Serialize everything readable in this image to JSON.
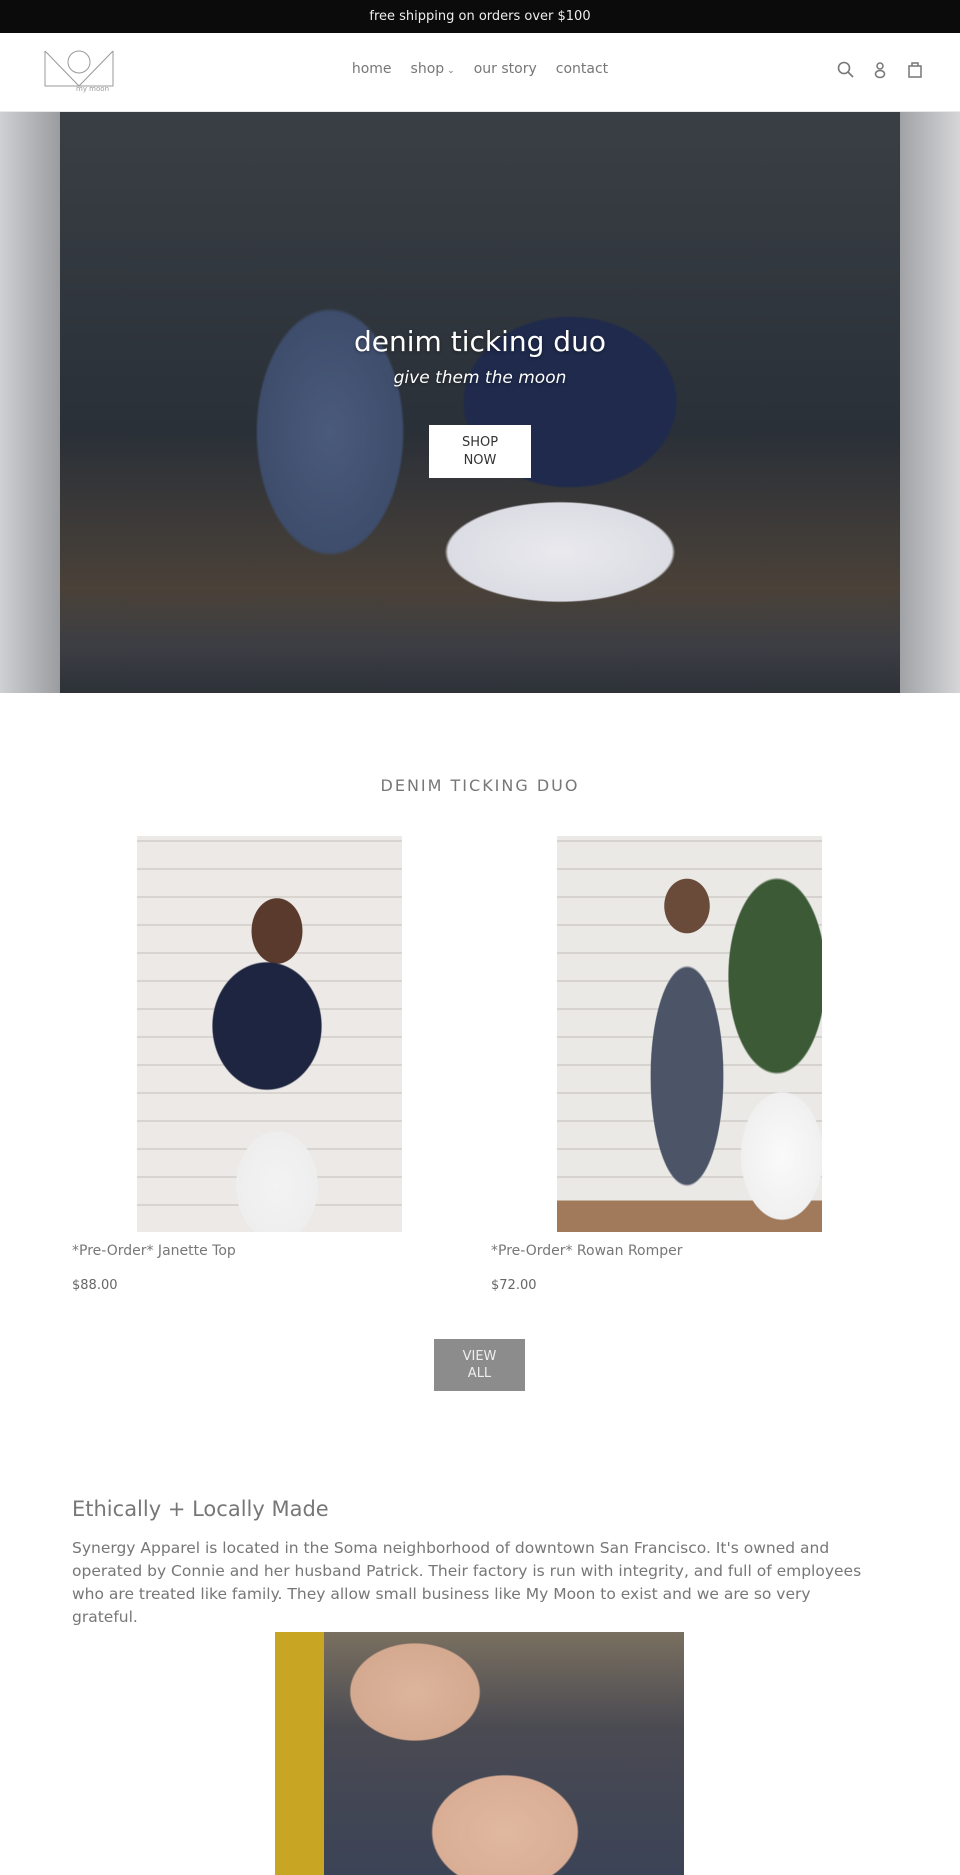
{
  "announcement": "free shipping on orders over $100",
  "header": {
    "logo_text": "my moon",
    "nav": [
      {
        "label": "home"
      },
      {
        "label": "shop",
        "has_dropdown": true
      },
      {
        "label": "our story"
      },
      {
        "label": "contact"
      }
    ],
    "icons": [
      "search-icon",
      "account-icon",
      "cart-icon"
    ],
    "chevron": "⌄"
  },
  "hero": {
    "title": "denim ticking duo",
    "subtitle": "give them the moon",
    "button": "SHOP\nNOW"
  },
  "collection": {
    "title": "DENIM TICKING DUO",
    "products": [
      {
        "title": "*Pre-Order* Janette Top",
        "price": "$88.00"
      },
      {
        "title": "*Pre-Order* Rowan Romper",
        "price": "$72.00"
      }
    ],
    "view_all": "VIEW\nALL"
  },
  "about": {
    "title": "Ethically + Locally Made",
    "text": "Synergy Apparel is located in the Soma neighborhood of downtown San Francisco. It's owned and operated by Connie and her husband Patrick. Their factory is run with integrity, and full of employees who are treated like family. They allow small business like My Moon to exist and we are so very grateful."
  },
  "colors": {
    "announcement_bg": "#0b0b0b",
    "button_gray": "#8c8c8c",
    "text": "#777777"
  }
}
